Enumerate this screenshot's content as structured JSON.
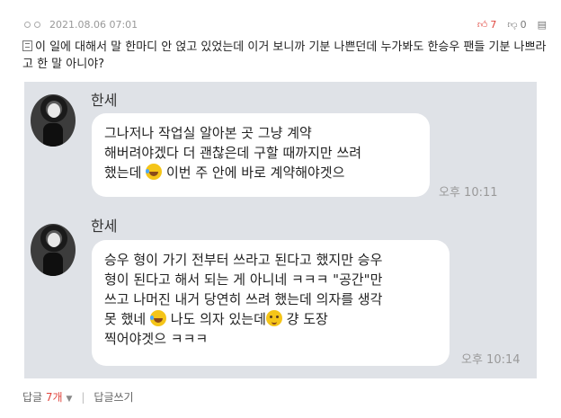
{
  "meta": {
    "date": "2021.08.06 07:01",
    "like_count": "7",
    "dislike_count": "0"
  },
  "comment": {
    "text": "이 일에 대해서 말 한마디 안 얹고 있었는데 이거 보니까 기분 나쁜던데 누가봐도 한승우 팬들 기분 나쁘라고 한 말 아니야?"
  },
  "chat": {
    "messages": [
      {
        "sender": "한세",
        "lines": [
          "그나저나 작업실 알아본 곳 그냥 계약",
          "해버려야겠다 더 괜찮은데 구할 때까지만 쓰려",
          "했는데",
          "이번 주 안에 바로 계약해야겟으"
        ],
        "time": "오후 10:11"
      },
      {
        "sender": "한세",
        "lines": [
          "승우 형이 가기 전부터 쓰라고 된다고 했지만 승우",
          "형이 된다고 해서 되는 게 아니네 ㅋㅋㅋ \"공간\"만",
          "쓰고 나머진 내거 당연히 쓰려 했는데 의자를 생각",
          "못 했네",
          "나도 의자 있는데",
          "걍 도장",
          "찍어야겟으 ㅋㅋㅋ"
        ],
        "time": "오후 10:14"
      }
    ]
  },
  "footer": {
    "reply_label": "답글",
    "reply_count": "7개",
    "write_reply": "답글쓰기"
  },
  "colors": {
    "like": "#e0463e",
    "chat_bg": "#dfe2e7",
    "bubble": "#ffffff"
  },
  "icons": [
    "circle-icon",
    "thumbs-up-icon",
    "thumbs-down-icon",
    "bookmark-icon",
    "image-icon",
    "laughing-emoji-icon",
    "wink-emoji-icon",
    "caret-down-icon"
  ]
}
